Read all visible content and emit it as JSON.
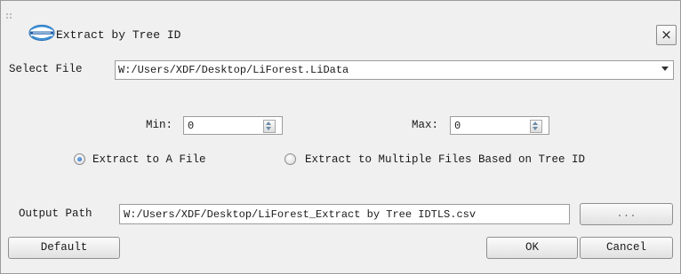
{
  "window": {
    "title": "Extract by Tree ID",
    "close_glyph": "×"
  },
  "icons": {
    "logo": "app-logo-icon",
    "close": "close-icon",
    "dropdown": "chevron-down-icon",
    "spin_up": "spin-up-icon",
    "spin_down": "spin-down-icon"
  },
  "select_file": {
    "label": "Select File",
    "value": "W:/Users/XDF/Desktop/LiForest.LiData"
  },
  "range": {
    "min_label": "Min:",
    "min_value": "0",
    "max_label": "Max:",
    "max_value": "0"
  },
  "extract_mode": {
    "options": [
      {
        "label": "Extract to A File",
        "checked": true
      },
      {
        "label": "Extract to Multiple Files Based on Tree ID",
        "checked": false
      }
    ]
  },
  "output": {
    "label": "Output Path",
    "value": "W:/Users/XDF/Desktop/LiForest_Extract by Tree IDTLS.csv",
    "browse_label": "..."
  },
  "buttons": {
    "default": "Default",
    "ok": "OK",
    "cancel": "Cancel"
  },
  "colors": {
    "window_bg": "#f0f0f0",
    "radio_accent": "#1b5fb8"
  }
}
